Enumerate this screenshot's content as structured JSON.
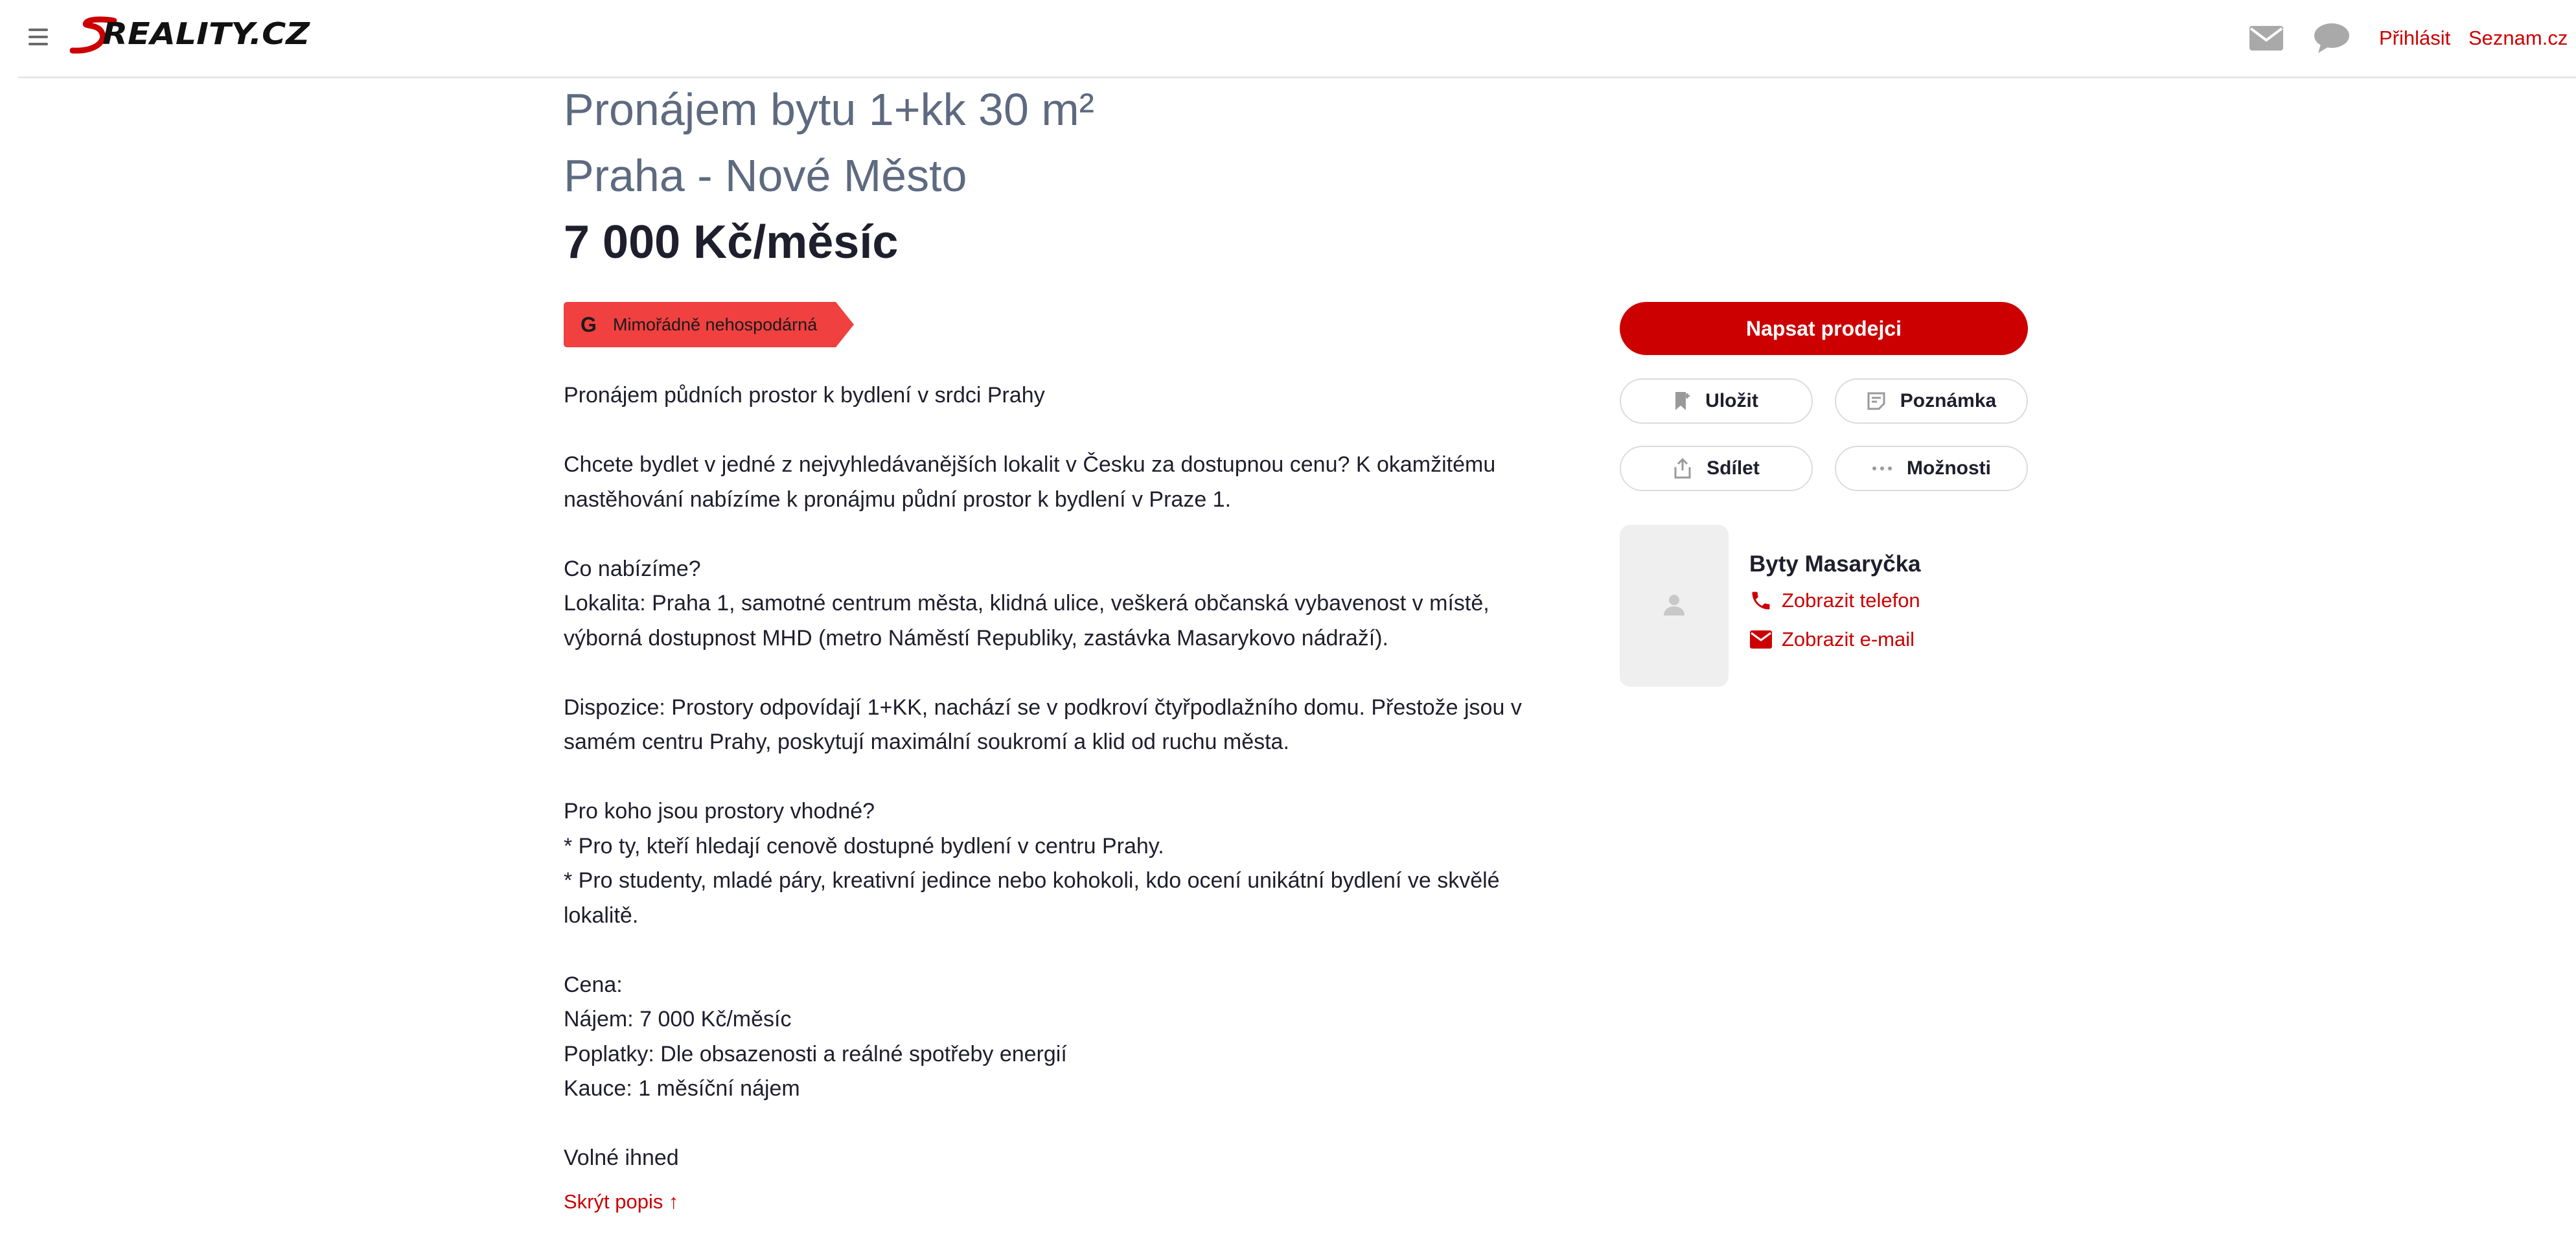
{
  "header": {
    "logo_text": "SREALITY.CZ",
    "login_label": "Přihlásit",
    "seznam_label": "Seznam.cz"
  },
  "listing": {
    "title": "Pronájem bytu 1+kk 30 m²",
    "location": "Praha - Nové Město",
    "price": "7 000 Kč/měsíc",
    "energy_badge": {
      "letter": "G",
      "label": "Mimořádně nehospodárná",
      "color": "#f04040"
    },
    "description": [
      "Pronájem půdních prostor k bydlení v srdci Prahy",
      "",
      "Chcete bydlet v jedné z nejvyhledávanějších lokalit v Česku za dostupnou cenu? K okamžitému nastěhování nabízíme k pronájmu půdní prostor k bydlení v Praze 1.",
      "",
      "Co nabízíme?",
      "Lokalita: Praha 1, samotné centrum města, klidná ulice, veškerá občanská vybavenost v místě, výborná dostupnost MHD (metro Náměstí Republiky, zastávka Masarykovo nádraží).",
      "",
      "Dispozice: Prostory odpovídají 1+KK, nachází se v podkroví čtyřpodlažního domu. Přestože jsou v samém centru Prahy, poskytují maximální soukromí a klid od ruchu města.",
      "",
      "Pro koho jsou prostory vhodné?",
      "* Pro ty, kteří hledají cenově dostupné bydlení v centru Prahy.",
      "* Pro studenty, mladé páry, kreativní jedince nebo kohokoli, kdo ocení unikátní bydlení ve skvělé lokalitě.",
      "",
      "Cena:",
      "Nájem: 7 000 Kč/měsíc",
      "Poplatky: Dle obsazenosti a reálné spotřeby energií",
      "Kauce: 1 měsíční nájem",
      "",
      "Volné ihned"
    ],
    "hide_description_label": "Skrýt popis ↑"
  },
  "actions": {
    "contact_seller": "Napsat prodejci",
    "save": "Uložit",
    "note": "Poznámka",
    "share": "Sdílet",
    "more": "Možnosti"
  },
  "seller": {
    "name": "Byty Masaryčka",
    "show_phone": "Zobrazit telefon",
    "show_email": "Zobrazit e-mail"
  },
  "colors": {
    "accent": "#cc0000",
    "title_gray": "#5d6a80"
  }
}
